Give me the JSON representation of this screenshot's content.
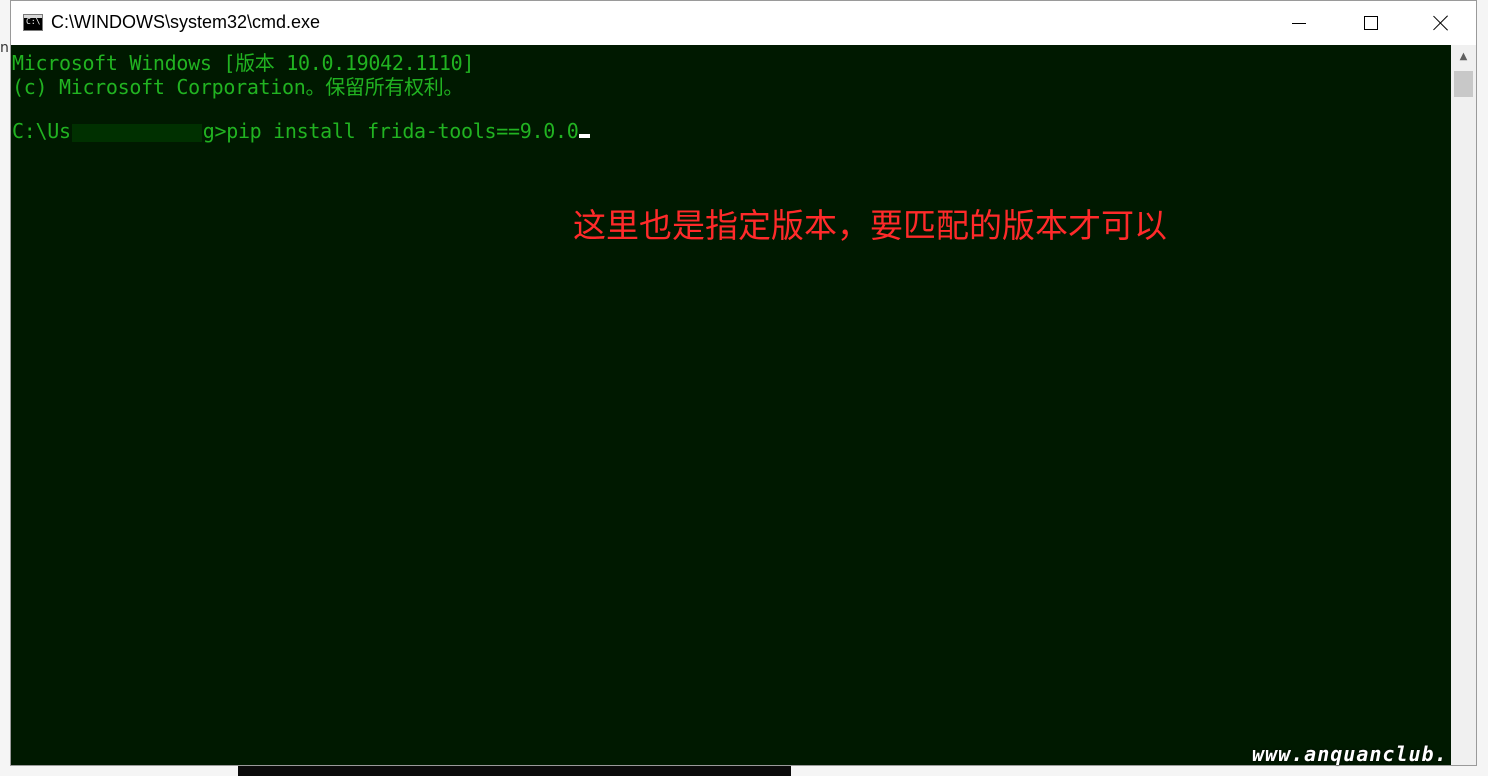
{
  "window": {
    "title": "C:\\WINDOWS\\system32\\cmd.exe",
    "icon": "cmd-icon",
    "buttons": {
      "minimize": "minimize-icon",
      "maximize": "maximize-icon",
      "close": "close-icon"
    }
  },
  "console": {
    "line1": "Microsoft Windows [版本 10.0.19042.1110]",
    "line2": "(c) Microsoft Corporation。保留所有权利。",
    "prompt_prefix": "C:\\Us",
    "prompt_suffix": "g>",
    "command": "pip install frida-tools==9.0.0",
    "background_color": "#001900",
    "text_color": "#21b321"
  },
  "annotation": {
    "text": "这里也是指定版本，要匹配的版本才可以",
    "color": "#ff2a2a"
  },
  "watermark": {
    "text": "www.anquanclub."
  }
}
